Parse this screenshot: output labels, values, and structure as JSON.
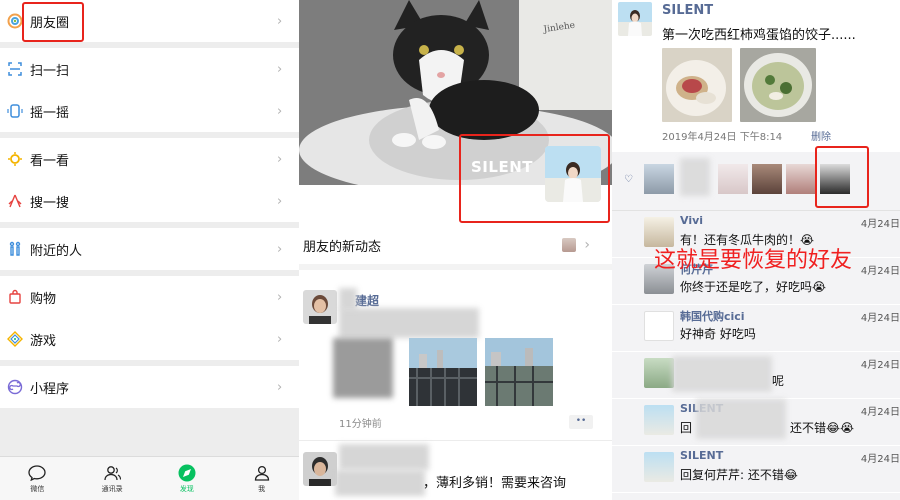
{
  "discover_menu": {
    "items": [
      {
        "label": "朋友圈",
        "icon": "moments-icon"
      },
      {
        "label": "扫一扫",
        "icon": "scan-icon"
      },
      {
        "label": "摇一摇",
        "icon": "shake-icon"
      },
      {
        "label": "看一看",
        "icon": "top-stories-icon"
      },
      {
        "label": "搜一搜",
        "icon": "search-icon"
      },
      {
        "label": "附近的人",
        "icon": "people-nearby-icon"
      },
      {
        "label": "购物",
        "icon": "shopping-icon"
      },
      {
        "label": "游戏",
        "icon": "games-icon"
      },
      {
        "label": "小程序",
        "icon": "mini-programs-icon"
      }
    ],
    "arrow": "›"
  },
  "tabbar": {
    "tabs": [
      {
        "label": "微信",
        "icon": "chat-icon"
      },
      {
        "label": "通讯录",
        "icon": "contacts-icon"
      },
      {
        "label": "发现",
        "icon": "discover-icon",
        "active": true
      },
      {
        "label": "我",
        "icon": "me-icon"
      }
    ],
    "active_color": "#07c160"
  },
  "moments": {
    "profile_name": "SILENT",
    "new_updates_label": "朋友的新动态",
    "posts": [
      {
        "name_fragment": "建超",
        "time": "11分钟前"
      },
      {
        "text": "，薄利多销！需要来咨询"
      }
    ]
  },
  "post_detail": {
    "author": "SILENT",
    "text": "第一次吃西红柿鸡蛋馅的饺子......",
    "date": "2019年4月24日 下午8:14",
    "delete_label": "删除",
    "like_icon": "heart-icon",
    "comment_icon": "comment-icon",
    "comments": [
      {
        "name": "Vivi",
        "text": "有！还有冬瓜牛肉的！😭",
        "date": "4月24日"
      },
      {
        "name": "何芹芹",
        "text": "你终于还是吃了，好吃吗😭",
        "date": "4月24日"
      },
      {
        "name": "韩国代购cici",
        "text": "好神奇 好吃吗",
        "date": "4月24日"
      },
      {
        "name": "",
        "text": "呢",
        "date": "4月24日"
      },
      {
        "name": "SILENT",
        "text": "还不错😂😭",
        "date": "4月24日"
      },
      {
        "name": "SILENT",
        "text": "回复何芹芹: 还不错😂",
        "date": "4月24日"
      }
    ],
    "comment_reply_prefix": "回",
    "overlay_annotation": "这就是要恢复的好友",
    "annotation_color": "#f02020"
  }
}
